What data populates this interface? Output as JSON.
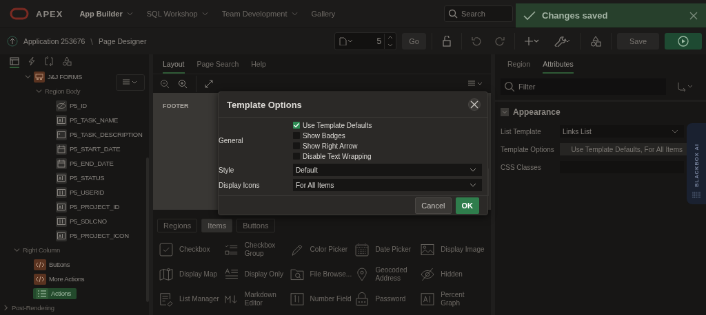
{
  "header": {
    "logo_text": "APEX",
    "nav": [
      {
        "label": "App Builder",
        "has_menu": true,
        "selected": true
      },
      {
        "label": "SQL Workshop",
        "has_menu": true,
        "selected": false
      },
      {
        "label": "Team Development",
        "has_menu": true,
        "selected": false
      },
      {
        "label": "Gallery",
        "has_menu": false,
        "selected": false
      }
    ],
    "search": {
      "placeholder": "Search"
    }
  },
  "toast": {
    "message": "Changes saved"
  },
  "breadcrumb": {
    "items": [
      "Application 253676",
      "Page Designer"
    ],
    "separator": "\\"
  },
  "toolbar": {
    "page_number": "5",
    "go": "Go",
    "save": "Save"
  },
  "left_panel": {
    "tabs": [
      {
        "kind": "rendering",
        "selected": true
      },
      {
        "kind": "dynamic-actions",
        "selected": false
      },
      {
        "kind": "processing",
        "selected": false
      },
      {
        "kind": "shared",
        "selected": false
      }
    ],
    "tree": {
      "children": [
        {
          "children": [
            {
              "children": [
                {
                  "label": "J&J FORMS",
                  "kind": "region",
                  "expanded": true,
                  "selected": false,
                  "children": [
                    {
                      "label": "Region Body",
                      "kind": "slot",
                      "expanded": true,
                      "selected": false,
                      "children": [
                        {
                          "label": "P5_ID",
                          "kind": "hidden",
                          "selected": false
                        },
                        {
                          "label": "P5_TASK_NAME",
                          "kind": "text",
                          "selected": false
                        },
                        {
                          "label": "P5_TASK_DESCRIPTION",
                          "kind": "textarea",
                          "selected": false
                        },
                        {
                          "label": "P5_START_DATE",
                          "kind": "date",
                          "selected": false
                        },
                        {
                          "label": "P5_END_DATE",
                          "kind": "date",
                          "selected": false
                        },
                        {
                          "label": "P5_STATUS",
                          "kind": "text",
                          "selected": false
                        },
                        {
                          "label": "P5_USERID",
                          "kind": "number",
                          "selected": false
                        },
                        {
                          "label": "P5_PROJECT_ID",
                          "kind": "text",
                          "selected": false
                        },
                        {
                          "label": "P5_SDLCNO",
                          "kind": "number",
                          "selected": false
                        },
                        {
                          "label": "P5_PROJECT_ICON",
                          "kind": "text",
                          "selected": false
                        }
                      ]
                    }
                  ]
                }
              ]
            },
            {
              "label": "Right Column",
              "kind": "slot",
              "expanded": true,
              "selected": false,
              "children": [
                {
                  "label": "Buttons",
                  "kind": "static",
                  "selected": false
                },
                {
                  "label": "More Actions",
                  "kind": "static",
                  "selected": false
                },
                {
                  "label": "Actions",
                  "kind": "list",
                  "selected": true
                }
              ]
            }
          ]
        },
        {
          "label": "Post-Rendering",
          "kind": "slot",
          "expanded": false,
          "selected": false
        }
      ]
    }
  },
  "center": {
    "tabs": [
      {
        "label": "Layout",
        "selected": true
      },
      {
        "label": "Page Search",
        "selected": false
      },
      {
        "label": "Help",
        "selected": false
      }
    ],
    "footer_label": "FOOTER",
    "gallery_tabs": [
      {
        "label": "Regions",
        "selected": false
      },
      {
        "label": "Items",
        "selected": true
      },
      {
        "label": "Buttons",
        "selected": false
      }
    ],
    "gallery": [
      {
        "label": "Checkbox",
        "kind": "checkbox"
      },
      {
        "label": "Checkbox Group",
        "kind": "checklist"
      },
      {
        "label": "Color Picker",
        "kind": "pen"
      },
      {
        "label": "Date Picker",
        "kind": "calendar"
      },
      {
        "label": "Display Image",
        "kind": "image"
      },
      {
        "label": "Display Map",
        "kind": "map"
      },
      {
        "label": "Display Only",
        "kind": "lines"
      },
      {
        "label": "File Browse...",
        "kind": "folder"
      },
      {
        "label": "Geocoded Address",
        "kind": "pin"
      },
      {
        "label": "Hidden",
        "kind": "eye-off"
      },
      {
        "label": "List Manager",
        "kind": "list"
      },
      {
        "label": "Markdown Editor",
        "kind": "markdown"
      },
      {
        "label": "Number Field",
        "kind": "number"
      },
      {
        "label": "Password",
        "kind": "lock"
      },
      {
        "label": "Percent Graph",
        "kind": "text"
      }
    ]
  },
  "right_panel": {
    "tabs": [
      {
        "label": "Region",
        "selected": false
      },
      {
        "label": "Attributes",
        "selected": true
      }
    ],
    "filter": {
      "placeholder": "Filter"
    },
    "section": {
      "title": "Appearance",
      "expanded": true
    },
    "fields": [
      {
        "label": "List Template",
        "kind": "select",
        "value": "Links List"
      },
      {
        "label": "Template Options",
        "kind": "button",
        "value": "Use Template Defaults, For All Items"
      },
      {
        "label": "CSS Classes",
        "kind": "text"
      }
    ],
    "side_tab": "BLACKBOX AI"
  },
  "dialog": {
    "title": "Template Options",
    "group_label": "General",
    "checkboxes": [
      {
        "label": "Use Template Defaults",
        "checked": true
      },
      {
        "label": "Show Badges",
        "checked": false
      },
      {
        "label": "Show Right Arrow",
        "checked": false
      },
      {
        "label": "Disable Text Wrapping",
        "checked": false
      }
    ],
    "selects": [
      {
        "label": "Style",
        "value": "Default"
      },
      {
        "label": "Display Icons",
        "value": "For All Items"
      }
    ],
    "buttons": {
      "cancel": "Cancel",
      "ok": "OK"
    }
  }
}
